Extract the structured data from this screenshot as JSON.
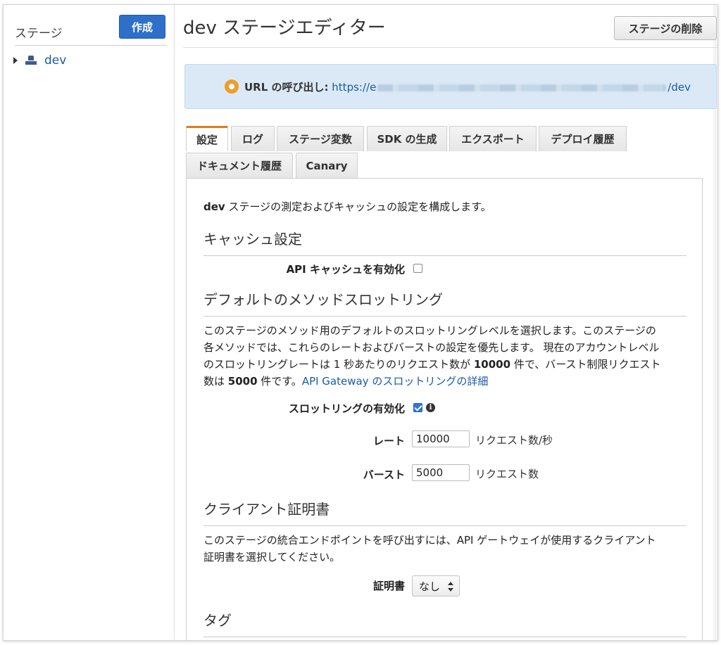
{
  "sidebar": {
    "title": "ステージ",
    "create_button": "作成",
    "stages": [
      {
        "label": "dev",
        "icon": "stage-icon"
      }
    ]
  },
  "header": {
    "title": "dev ステージエディター",
    "delete_button": "ステージの削除"
  },
  "info": {
    "label": "URL の呼び出し:",
    "url_start": "https://e",
    "url_end": "/dev"
  },
  "tabs": [
    {
      "label": "設定",
      "active": true
    },
    {
      "label": "ログ"
    },
    {
      "label": "ステージ変数"
    },
    {
      "label": "SDK の生成"
    },
    {
      "label": "エクスポート"
    },
    {
      "label": "デプロイ履歴"
    },
    {
      "label": "ドキュメント履歴"
    },
    {
      "label": "Canary"
    }
  ],
  "settings": {
    "intro_bold": "dev",
    "intro_rest": " ステージの測定およびキャッシュの設定を構成します。",
    "cache": {
      "heading": "キャッシュ設定",
      "enable_label": "API キャッシュを有効化",
      "enabled": false
    },
    "throttling": {
      "heading": "デフォルトのメソッドスロットリング",
      "desc_line1": "このステージのメソッド用のデフォルトのスロットリングレベルを選択します。このステージの",
      "desc_line2": "各メソッドでは、これらのレートおよびバーストの設定を優先します。 現在のアカウントレベル",
      "desc_line3_a": "のスロットリングレートは 1 秒あたりのリクエスト数が ",
      "desc_line3_num": "10000",
      "desc_line3_b": " 件で、バースト制限リクエスト",
      "desc_line4_a": "数は ",
      "desc_line4_num": "5000",
      "desc_line4_b": " 件です。",
      "details_link": "API Gateway のスロットリングの詳細",
      "enable_label": "スロットリングの有効化",
      "enabled": true,
      "rate_label": "レート",
      "rate_value": "10000",
      "rate_unit": "リクエスト数/秒",
      "burst_label": "バースト",
      "burst_value": "5000",
      "burst_unit": "リクエスト数"
    },
    "client_cert": {
      "heading": "クライアント証明書",
      "desc_line1": "このステージの統合エンドポイントを呼び出すには、API ゲートウェイが使用するクライアント",
      "desc_line2": "証明書を選択してください。",
      "cert_label": "証明書",
      "cert_value": "なし"
    },
    "tags": {
      "heading": "タグ"
    }
  }
}
